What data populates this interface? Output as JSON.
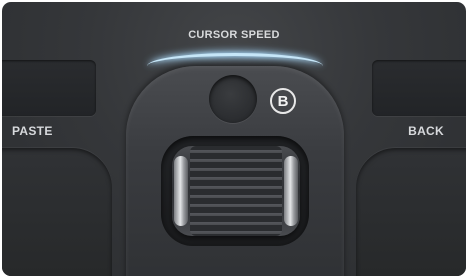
{
  "device": {
    "cursor_speed_label": "CURSOR SPEED",
    "left_button_label": "PASTE",
    "right_button_label": "BACK",
    "marker_label": "B"
  },
  "colors": {
    "body": "#35373a",
    "label_text": "#d8dadc",
    "speed_indicator_glow": "#c6e6f8"
  }
}
